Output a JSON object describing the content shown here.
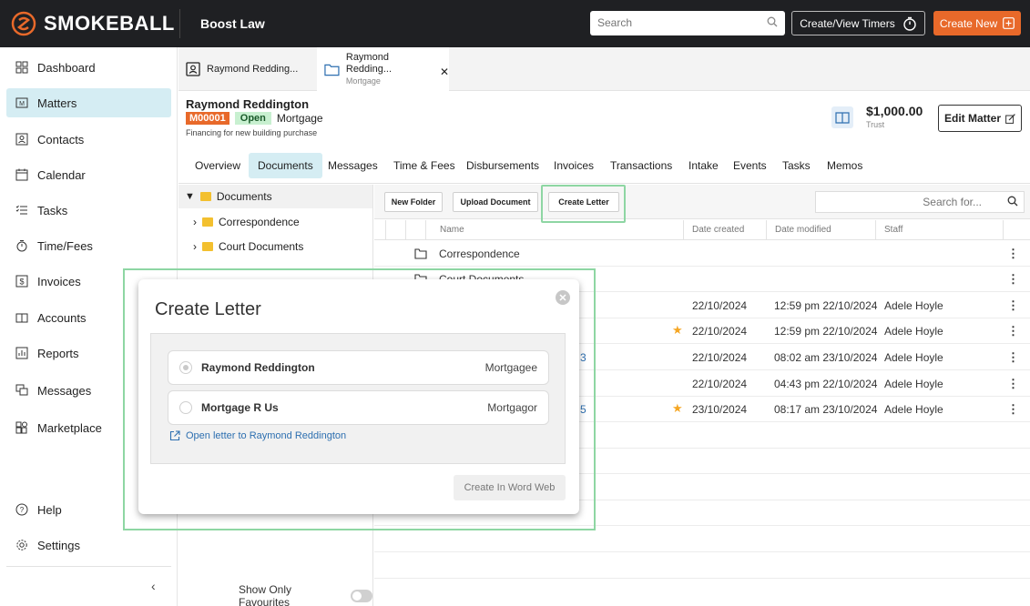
{
  "brand": {
    "name": "SMOKEBALL",
    "accent": "#e8692a"
  },
  "topbar": {
    "firm": "Boost Law",
    "search_placeholder": "Search",
    "timers_label": "Create/View Timers",
    "create_new_label": "Create New"
  },
  "sidebar": {
    "items": [
      {
        "label": "Dashboard",
        "icon": "dashboard-icon"
      },
      {
        "label": "Matters",
        "icon": "matters-icon",
        "active": true
      },
      {
        "label": "Contacts",
        "icon": "contacts-icon"
      },
      {
        "label": "Calendar",
        "icon": "calendar-icon"
      },
      {
        "label": "Tasks",
        "icon": "tasks-icon"
      },
      {
        "label": "Time/Fees",
        "icon": "timer-icon"
      },
      {
        "label": "Invoices",
        "icon": "invoice-icon"
      },
      {
        "label": "Accounts",
        "icon": "accounts-icon"
      },
      {
        "label": "Reports",
        "icon": "reports-icon"
      },
      {
        "label": "Messages",
        "icon": "messages-icon"
      },
      {
        "label": "Marketplace",
        "icon": "marketplace-icon"
      },
      {
        "label": "Help",
        "icon": "help-icon"
      },
      {
        "label": "Settings",
        "icon": "settings-icon"
      }
    ]
  },
  "matter_tabs": [
    {
      "label": "Raymond Redding..."
    },
    {
      "label": "Raymond Redding...",
      "sub": "Mortgage"
    }
  ],
  "matter": {
    "name": "Raymond Reddington",
    "number": "M00001",
    "status": "Open",
    "type": "Mortgage",
    "description": "Financing for new building purchase",
    "trust_amount": "$1,000.00",
    "trust_label": "Trust",
    "edit_label": "Edit Matter"
  },
  "content_tabs": [
    "Overview",
    "Documents",
    "Messages",
    "Time & Fees",
    "Disbursements",
    "Invoices",
    "Transactions",
    "Intake",
    "Events",
    "Tasks",
    "Memos"
  ],
  "tree": {
    "root": "Documents",
    "children": [
      "Correspondence",
      "Court Documents"
    ],
    "show_favourites": "Show Only Favourites"
  },
  "toolbar": {
    "new_folder": "New Folder",
    "upload": "Upload Document",
    "create_letter": "Create Letter",
    "search_placeholder": "Search for..."
  },
  "table": {
    "columns": [
      "Name",
      "Date created",
      "Date modified",
      "Staff"
    ],
    "rows": [
      {
        "name": "Correspondence",
        "created": "",
        "modified": "",
        "staff": "",
        "folder": true
      },
      {
        "name": "Court Documents",
        "created": "",
        "modified": "",
        "staff": "",
        "folder": true
      },
      {
        "name": "",
        "created": "22/10/2024",
        "modified": "12:59 pm 22/10/2024",
        "staff": "Adele Hoyle"
      },
      {
        "name": "",
        "created": "22/10/2024",
        "modified": "12:59 pm 22/10/2024",
        "staff": "Adele Hoyle",
        "star": true
      },
      {
        "name": "3",
        "created": "22/10/2024",
        "modified": "08:02 am 23/10/2024",
        "staff": "Adele Hoyle"
      },
      {
        "name": "",
        "created": "22/10/2024",
        "modified": "04:43 pm 22/10/2024",
        "staff": "Adele Hoyle"
      },
      {
        "name": "5",
        "created": "23/10/2024",
        "modified": "08:17 am 23/10/2024",
        "staff": "Adele Hoyle",
        "star": true
      }
    ]
  },
  "modal": {
    "title": "Create Letter",
    "parties": [
      {
        "name": "Raymond Reddington",
        "role": "Mortgagee",
        "selected": true
      },
      {
        "name": "Mortgage R Us",
        "role": "Mortgagor",
        "selected": false
      }
    ],
    "open_letter": "Open letter to Raymond Reddington",
    "create_button": "Create In Word Web"
  }
}
